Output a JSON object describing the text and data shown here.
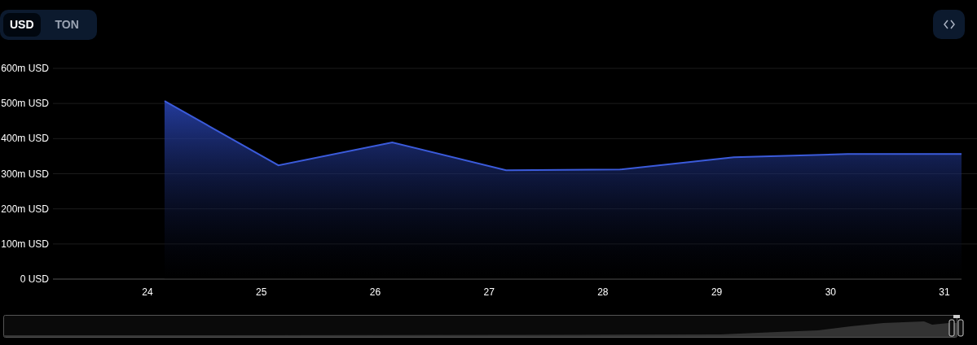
{
  "currency_tabs": [
    {
      "label": "USD",
      "selected": true
    },
    {
      "label": "TON",
      "selected": false
    }
  ],
  "chart": {
    "chart_data": {
      "type": "area",
      "x": [
        24.15,
        25.15,
        26.15,
        27.15,
        28.15,
        29.15,
        30.15,
        31.15
      ],
      "grid": true,
      "series": [
        {
          "color": "#3b5bdb",
          "values": [
            507,
            324,
            389,
            310,
            312,
            347,
            356,
            356
          ]
        }
      ],
      "xlim": [
        23.17,
        31.15
      ],
      "ylim": [
        0,
        600
      ],
      "xticks": [
        24,
        25,
        26,
        27,
        28,
        29,
        30,
        31
      ],
      "yticks": [
        {
          "value": 0,
          "label": "0 USD"
        },
        {
          "value": 100,
          "label": "100m USD"
        },
        {
          "value": 200,
          "label": "200m USD"
        },
        {
          "value": 300,
          "label": "300m USD"
        },
        {
          "value": 400,
          "label": "400m USD"
        },
        {
          "value": 500,
          "label": "500m USD"
        },
        {
          "value": 600,
          "label": "600m USD"
        }
      ]
    }
  }
}
